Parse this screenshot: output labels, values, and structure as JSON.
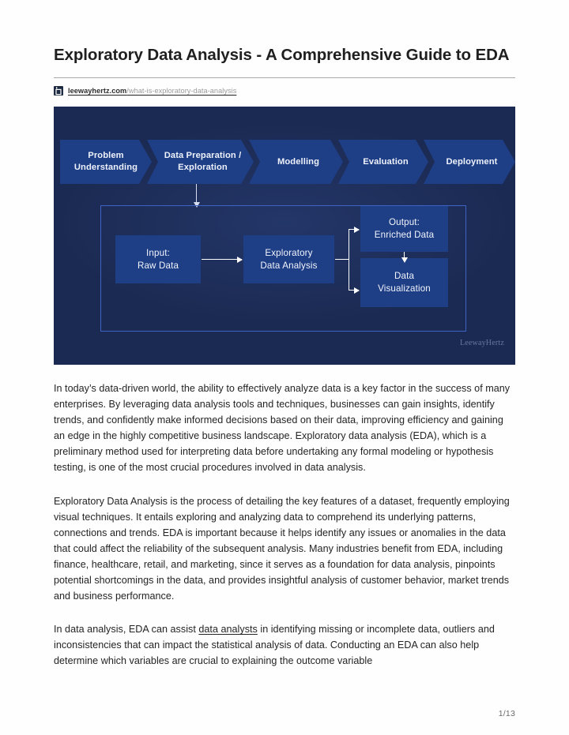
{
  "document": {
    "title": "Exploratory Data Analysis - A Comprehensive Guide to EDA",
    "page_indicator": "1/13"
  },
  "source": {
    "favicon_name": "leewayhertz-logo-icon",
    "domain": "leewayhertz.com",
    "path": "/what-is-exploratory-data-analysis"
  },
  "diagram": {
    "watermark": "LeewayHertz",
    "colors": {
      "background": "#1b2a52",
      "node": "#1e3e86",
      "outline": "#3f63c4",
      "arrow": "#ffffff",
      "text": "#f2f5fc"
    },
    "pipeline_steps": [
      {
        "label": "Problem\nUnderstanding",
        "line1": "Problem",
        "line2": "Understanding"
      },
      {
        "label": "Data Preparation / Exploration",
        "line1": "Data Preparation",
        "line2": "/ Exploration"
      },
      {
        "label": "Modelling",
        "line1": "Modelling",
        "line2": ""
      },
      {
        "label": "Evaluation",
        "line1": "Evaluation",
        "line2": ""
      },
      {
        "label": "Deployment",
        "line1": "Deployment",
        "line2": ""
      }
    ],
    "nodes": {
      "input": {
        "line1": "Input:",
        "line2": "Raw Data"
      },
      "eda": {
        "line1": "Exploratory",
        "line2": "Data Analysis"
      },
      "output": {
        "line1": "Output:",
        "line2": "Enriched Data"
      },
      "visualization": {
        "line1": "Data",
        "line2": "Visualization"
      }
    }
  },
  "body": {
    "paragraph_1": "In today’s data-driven world, the ability to effectively analyze data is a key factor in the success of many enterprises. By leveraging data analysis tools and techniques, businesses can gain insights, identify trends, and confidently make informed decisions based on their data, improving efficiency and gaining an edge in the highly competitive business landscape. Exploratory data analysis (EDA), which is a preliminary method used for interpreting data before undertaking any formal modeling or hypothesis testing, is one of the most crucial procedures involved in data analysis.",
    "paragraph_2": "Exploratory Data Analysis is the process of detailing the key features of a dataset, frequently employing visual techniques. It entails exploring and analyzing data to comprehend its underlying patterns, connections and trends. EDA is important because it helps identify any issues or anomalies in the data that could affect the reliability of the subsequent analysis. Many industries benefit from EDA, including finance, healthcare, retail, and marketing, since it serves as a foundation for data analysis, pinpoints potential shortcomings in the data, and provides insightful analysis of customer behavior, market trends and business performance.",
    "paragraph_3_before_link": "In data analysis, EDA can assist ",
    "paragraph_3_link": "data analysts",
    "paragraph_3_after_link": " in identifying missing or incomplete data, outliers and inconsistencies that can impact the statistical analysis of data. Conducting an EDA can also help determine which variables are crucial to explaining the outcome variable"
  }
}
